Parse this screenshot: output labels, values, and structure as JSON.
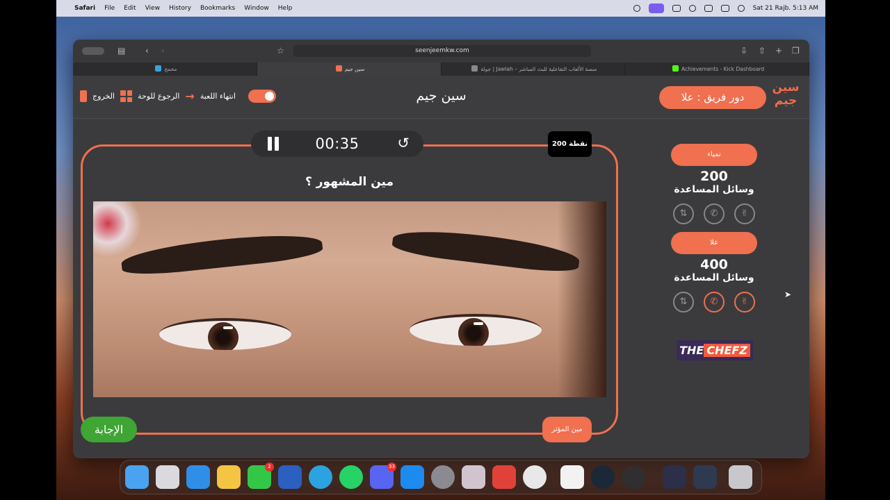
{
  "menubar": {
    "app": "Safari",
    "items": [
      "File",
      "Edit",
      "View",
      "History",
      "Bookmarks",
      "Window",
      "Help"
    ],
    "datetime": "Sat 21 Rajb.  5:13 AM"
  },
  "browser": {
    "url": "seenjeemkw.com",
    "tabs": [
      {
        "label": "مخمخ",
        "active": false,
        "color": "#3aa0e0"
      },
      {
        "label": "سين جيم",
        "active": true,
        "color": "#f0704f"
      },
      {
        "label": "جولة | Jawlah – منصة الألعاب التفاعلية للبث المباشر",
        "active": false,
        "color": "#888888"
      },
      {
        "label": "Achievements - Kick Dashboard",
        "active": false,
        "color": "#53fc18"
      }
    ]
  },
  "header": {
    "logo_text": "سين جيم",
    "team_turn": "دور فريق : علا",
    "title": "سين جيم",
    "exit_label": "الخروج",
    "back_label": "الرجوع للوحة",
    "end_label": "انتهاء اللعبة"
  },
  "question": {
    "timer": "00:35",
    "points": "200 نقطة",
    "text": "مين المشهور ؟",
    "answer_label": "الإجابة",
    "who_label": "مين المؤثر"
  },
  "teams": [
    {
      "name": "نمياء",
      "score": "200",
      "aids_label": "وسائل المساعدة",
      "aids": [
        {
          "icon": "two-hands-icon",
          "active": false
        },
        {
          "icon": "phone-icon",
          "active": false
        },
        {
          "icon": "peace-hand-icon",
          "active": false
        }
      ]
    },
    {
      "name": "علا",
      "score": "400",
      "aids_label": "وسائل المساعدة",
      "aids": [
        {
          "icon": "two-hands-icon",
          "active": false
        },
        {
          "icon": "phone-icon",
          "active": true
        },
        {
          "icon": "peace-hand-icon",
          "active": true
        }
      ]
    }
  ],
  "sponsor": {
    "left": "THE",
    "right": "CHEFZ"
  },
  "dock": {
    "apps": [
      {
        "name": "finder",
        "color": "#4aa3f0"
      },
      {
        "name": "launchpad",
        "color": "#d9d9de"
      },
      {
        "name": "safari",
        "color": "#2f8fe8"
      },
      {
        "name": "photos",
        "color": "#f4c542"
      },
      {
        "name": "facetime",
        "color": "#33c748",
        "badge": "2"
      },
      {
        "name": "word",
        "color": "#2b5fc0"
      },
      {
        "name": "telegram",
        "color": "#2aa3e0"
      },
      {
        "name": "whatsapp",
        "color": "#25d366"
      },
      {
        "name": "discord",
        "color": "#5865f2",
        "badge": "33"
      },
      {
        "name": "app-store",
        "color": "#1d8af0"
      },
      {
        "name": "system-settings",
        "color": "#8a8a90"
      },
      {
        "name": "iphone-mirroring",
        "color": "#d0c4cf"
      },
      {
        "name": "parallels",
        "color": "#e0423a"
      },
      {
        "name": "chrome",
        "color": "#e8e8e8"
      },
      {
        "name": "vpn-app",
        "color": "#f2f2f2"
      },
      {
        "name": "steam",
        "color": "#1b2838"
      },
      {
        "name": "obs",
        "color": "#302e31"
      },
      {
        "name": "discord-window",
        "color": "#2c2f48"
      },
      {
        "name": "obs-window",
        "color": "#2d3a4f"
      },
      {
        "name": "trash",
        "color": "#c8c8cc"
      }
    ]
  }
}
